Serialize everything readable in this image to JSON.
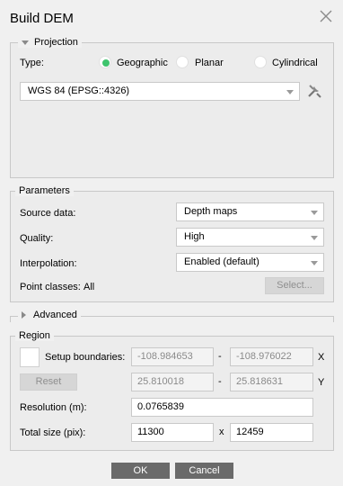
{
  "dialog": {
    "title": "Build DEM"
  },
  "projection": {
    "section_label": "Projection",
    "type_label": "Type:",
    "options": [
      "Geographic",
      "Planar",
      "Cylindrical"
    ],
    "selected": "Geographic",
    "crs_value": "WGS 84 (EPSG::4326)"
  },
  "parameters": {
    "section_label": "Parameters",
    "source_label": "Source data:",
    "source_value": "Depth maps",
    "quality_label": "Quality:",
    "quality_value": "High",
    "interp_label": "Interpolation:",
    "interp_value": "Enabled (default)",
    "classes_label": "Point classes:",
    "classes_value": "All",
    "select_button": "Select..."
  },
  "advanced": {
    "section_label": "Advanced"
  },
  "region": {
    "section_label": "Region",
    "setup_label": "Setup boundaries:",
    "x_min": "-108.984653",
    "x_max": "-108.976022",
    "x_axis": "X",
    "y_min": "25.810018",
    "y_max": "25.818631",
    "y_axis": "Y",
    "range_sep": "-",
    "reset_button": "Reset",
    "resolution_label": "Resolution (m):",
    "resolution_value": "0.0765839",
    "size_label": "Total size (pix):",
    "size_w": "11300",
    "size_sep": "x",
    "size_h": "12459"
  },
  "footer": {
    "ok": "OK",
    "cancel": "Cancel"
  },
  "colors": {
    "radio_selected": "#3ec46d",
    "button_dark": "#6a6a6a"
  }
}
